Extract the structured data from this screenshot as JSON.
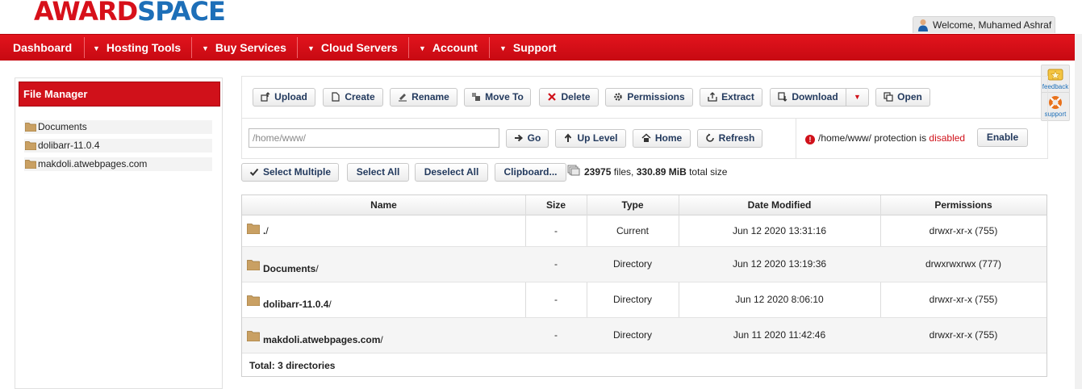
{
  "header": {
    "logo_part1": "AWARD",
    "logo_part2": "SPACE",
    "welcome": "Welcome, Muhamed Ashraf"
  },
  "nav": {
    "items": [
      {
        "label": "Dashboard",
        "dropdown": false
      },
      {
        "label": "Hosting Tools",
        "dropdown": true
      },
      {
        "label": "Buy Services",
        "dropdown": true
      },
      {
        "label": "Cloud Servers",
        "dropdown": true
      },
      {
        "label": "Account",
        "dropdown": true
      },
      {
        "label": "Support",
        "dropdown": true
      }
    ],
    "dropdown_glyph": "▼"
  },
  "side_tabs": {
    "feedback": "feedback",
    "support": "support"
  },
  "file_manager": {
    "title": "File Manager",
    "tree": [
      "Documents",
      "dolibarr-11.0.4",
      "makdoli.atwebpages.com"
    ]
  },
  "toolbar": {
    "upload": "Upload",
    "create": "Create",
    "rename": "Rename",
    "move_to": "Move To",
    "delete": "Delete",
    "permissions": "Permissions",
    "extract": "Extract",
    "download": "Download",
    "open": "Open"
  },
  "navigation": {
    "path_value": "/home/www/",
    "go": "Go",
    "up_level": "Up Level",
    "home": "Home",
    "refresh": "Refresh"
  },
  "protection": {
    "path": "/home/www/",
    "text": " protection is ",
    "status": "disabled",
    "enable": "Enable"
  },
  "selection": {
    "select_multiple": "Select Multiple",
    "select_all": "Select All",
    "deselect_all": "Deselect All",
    "clipboard": "Clipboard..."
  },
  "summary": {
    "files_count": "23975",
    "files_label": " files, ",
    "size": "330.89 MiB",
    "size_label": " total size"
  },
  "table": {
    "columns": [
      "Name",
      "Size",
      "Type",
      "Date Modified",
      "Permissions"
    ],
    "rows": [
      {
        "name": ".",
        "size": "-",
        "type": "Current",
        "date": "Jun 12 2020 13:31:16",
        "perm": "drwxr-xr-x (755)"
      },
      {
        "name": "Documents",
        "size": "-",
        "type": "Directory",
        "date": "Jun 12 2020 13:19:36",
        "perm": "drwxrwxrwx (777)"
      },
      {
        "name": "dolibarr-11.0.4",
        "size": "-",
        "type": "Directory",
        "date": "Jun 12 2020 8:06:10",
        "perm": "drwxr-xr-x (755)"
      },
      {
        "name": "makdoli.atwebpages.com",
        "size": "-",
        "type": "Directory",
        "date": "Jun 11 2020 11:42:46",
        "perm": "drwxr-xr-x (755)"
      }
    ],
    "trailing_slash": "/",
    "total": "Total: 3 directories"
  },
  "colors": {
    "brand_red": "#d7101a",
    "brand_blue": "#1d6fb8",
    "button_text": "#233a5e"
  }
}
